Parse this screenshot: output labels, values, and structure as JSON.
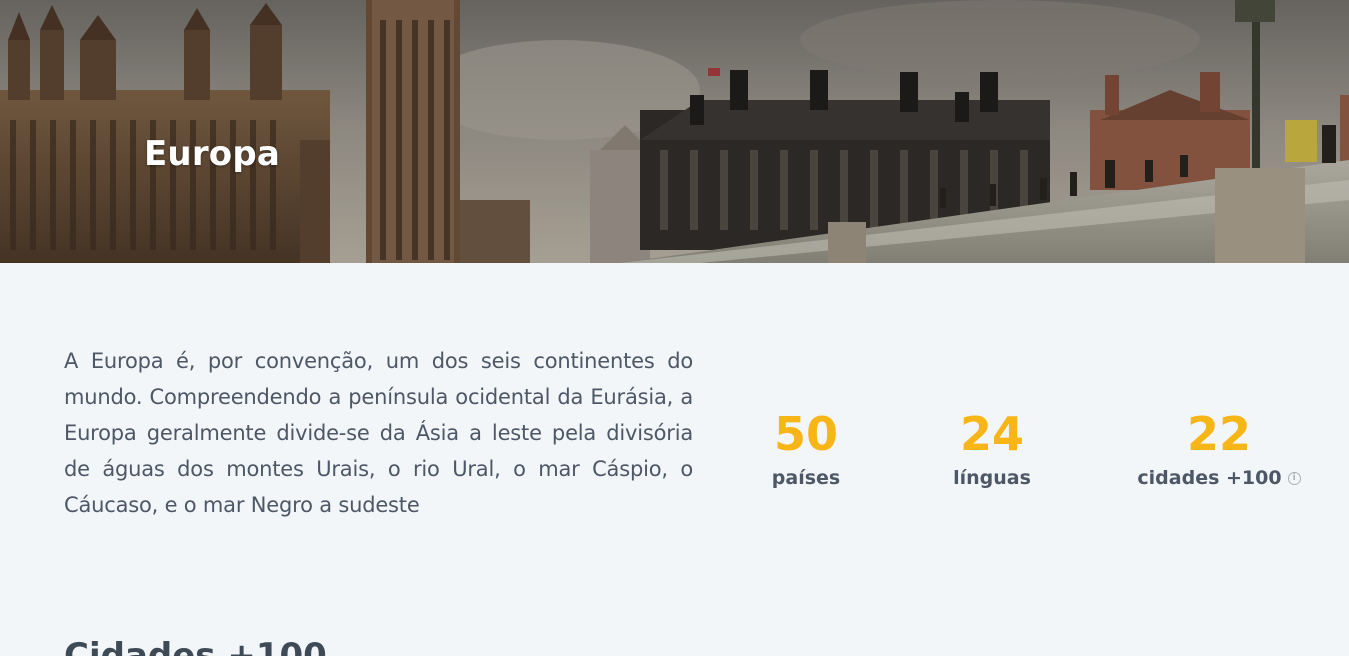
{
  "hero": {
    "title": "Europa",
    "image_subject": "london-westminster-skyline"
  },
  "intro": {
    "text": "A Europa é, por convenção, um dos seis continentes do mundo. Compreendendo a península ocidental da Eurásia, a Europa geralmente divide-se da Ásia a leste pela divisória de águas dos montes Urais, o rio Ural, o mar Cáspio, o Cáucaso, e o mar Negro a sudeste"
  },
  "stats": [
    {
      "value": "50",
      "label": "países"
    },
    {
      "value": "24",
      "label": "línguas"
    },
    {
      "value": "22",
      "label": "cidades +100",
      "info_icon": "info-icon"
    }
  ],
  "next_section": {
    "heading": "Cidades +100"
  },
  "colors": {
    "accent": "#f8b518",
    "text": "#4d5766",
    "background": "#f3f6f9"
  }
}
